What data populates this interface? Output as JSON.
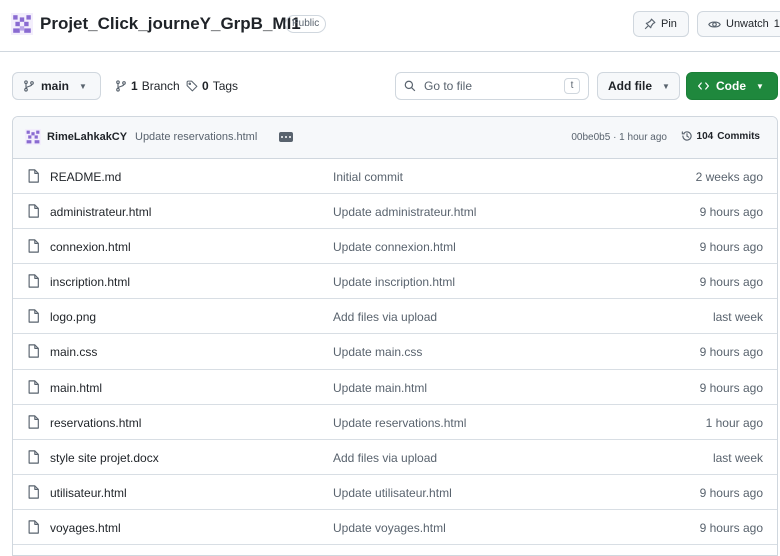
{
  "repo": {
    "name": "Projet_Click_journeY_GrpB_MI1",
    "visibility": "Public"
  },
  "header_actions": {
    "pin_label": "Pin",
    "watch_label": "Unwatch",
    "watch_count": "1"
  },
  "toolbar": {
    "branch": "main",
    "branches_count": "1",
    "branches_label": "Branch",
    "tags_count": "0",
    "tags_label": "Tags",
    "search_placeholder": "Go to file",
    "search_shortcut": "t",
    "add_file_label": "Add file",
    "code_label": "Code"
  },
  "latest_commit": {
    "author": "RimeLahkakCY",
    "message": "Update reservations.html",
    "hash_time": "00be0b5 · 1 hour ago",
    "commits_count": "104",
    "commits_label": "Commits"
  },
  "files": [
    {
      "name": "README.md",
      "message": "Initial commit",
      "time": "2 weeks ago"
    },
    {
      "name": "administrateur.html",
      "message": "Update administrateur.html",
      "time": "9 hours ago"
    },
    {
      "name": "connexion.html",
      "message": "Update connexion.html",
      "time": "9 hours ago"
    },
    {
      "name": "inscription.html",
      "message": "Update inscription.html",
      "time": "9 hours ago"
    },
    {
      "name": "logo.png",
      "message": "Add files via upload",
      "time": "last week"
    },
    {
      "name": "main.css",
      "message": "Update main.css",
      "time": "9 hours ago"
    },
    {
      "name": "main.html",
      "message": "Update main.html",
      "time": "9 hours ago"
    },
    {
      "name": "reservations.html",
      "message": "Update reservations.html",
      "time": "1 hour ago"
    },
    {
      "name": "style site projet.docx",
      "message": "Add files via upload",
      "time": "last week"
    },
    {
      "name": "utilisateur.html",
      "message": "Update utilisateur.html",
      "time": "9 hours ago"
    },
    {
      "name": "voyages.html",
      "message": "Update voyages.html",
      "time": "9 hours ago"
    }
  ],
  "colors": {
    "primary_button": "#1f883d",
    "border": "#d0d7de",
    "muted_text": "#59636e",
    "avatar_purple": "#8a6bd1"
  },
  "icons": {
    "avatar": "identicon-avatar",
    "pin": "pin-icon",
    "watch": "eye-icon",
    "branch": "git-branch-icon",
    "tag": "tag-icon",
    "search": "search-icon",
    "code": "code-icon",
    "history": "history-icon",
    "file": "file-icon"
  }
}
